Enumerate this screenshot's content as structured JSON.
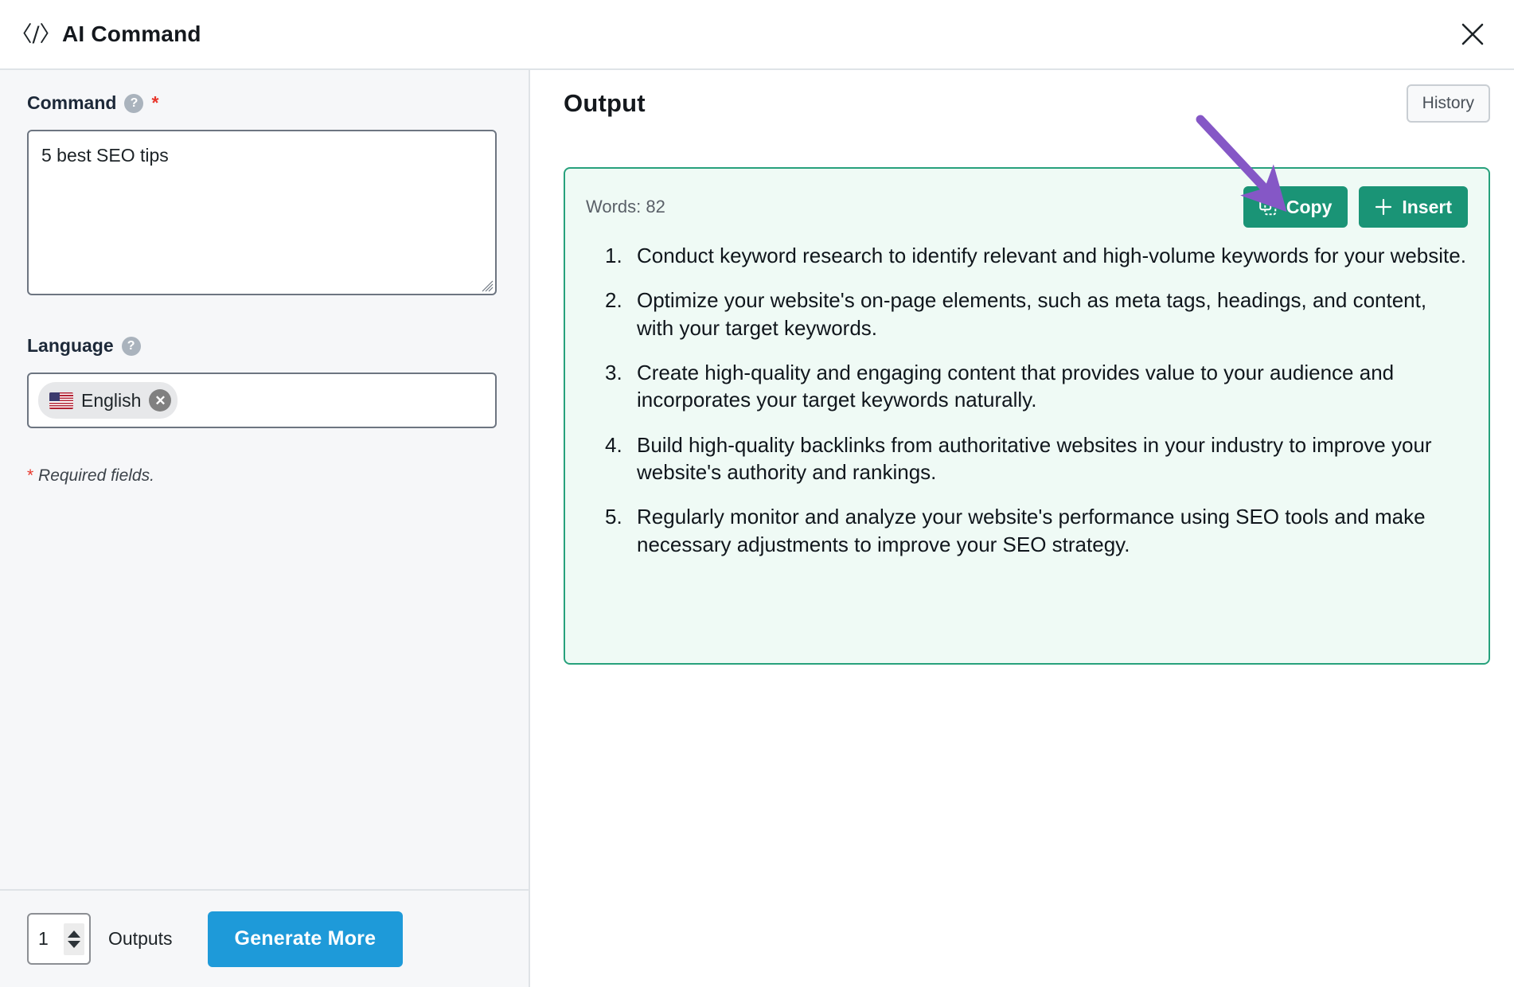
{
  "header": {
    "icon": "code-icon",
    "icon_glyph": "〈/〉",
    "title": "AI Command",
    "close_icon": "close-icon"
  },
  "left_panel": {
    "command": {
      "label": "Command",
      "help_icon": "question-mark-icon",
      "help_glyph": "?",
      "required_marker": "*",
      "value": "5 best SEO tips",
      "placeholder": ""
    },
    "language": {
      "label": "Language",
      "help_icon": "question-mark-icon",
      "help_glyph": "?",
      "chip_label": "English",
      "chip_flag": "us-flag-icon",
      "chip_remove_glyph": "✕"
    },
    "required_note": {
      "star": "*",
      "text": " Required fields."
    },
    "footer": {
      "outputs_value": "1",
      "outputs_label": "Outputs",
      "generate_label": "Generate More"
    }
  },
  "right_panel": {
    "title": "Output",
    "history_label": "History",
    "card": {
      "words_label": "Words: 82",
      "copy_label": "Copy",
      "copy_icon": "copy-icon",
      "insert_label": "Insert",
      "insert_icon": "plus-icon",
      "items": [
        "Conduct keyword research to identify relevant and high-volume keywords for your website.",
        "Optimize your website's on-page elements, such as meta tags, headings, and content, with your target keywords.",
        "Create high-quality and engaging content that provides value to your audience and incorporates your target keywords naturally.",
        "Build high-quality backlinks from authoritative websites in your industry to improve your website's authority and rankings.",
        "Regularly monitor and analyze your website's performance using SEO tools and make necessary adjustments to improve your SEO strategy."
      ]
    }
  },
  "annotation": {
    "type": "arrow",
    "color": "#8557c6",
    "points_to": "copy-button"
  },
  "colors": {
    "accent_blue": "#1e9ad9",
    "accent_green": "#1a9476",
    "card_border_green": "#27a17c",
    "card_bg_green": "#effaf5",
    "panel_bg": "#f6f7f9",
    "required_red": "#e8362b",
    "annotation_purple": "#8557c6"
  }
}
